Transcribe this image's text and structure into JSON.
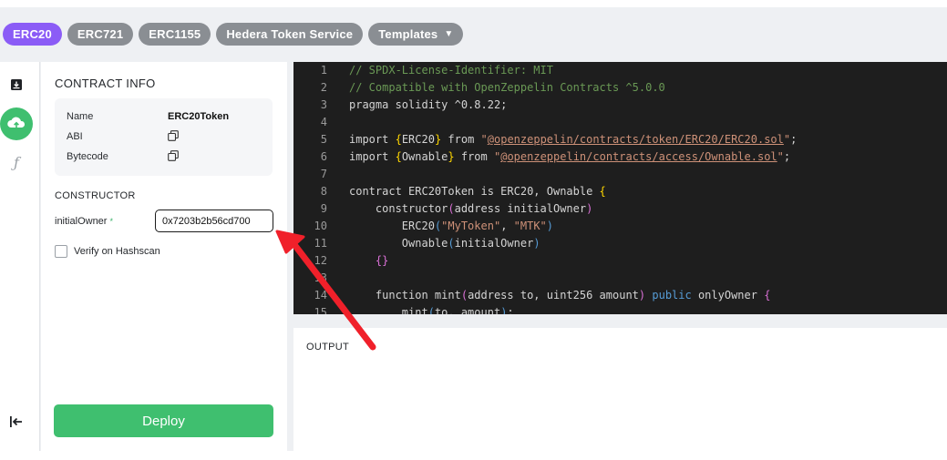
{
  "tabs": [
    {
      "label": "ERC20",
      "active": true
    },
    {
      "label": "ERC721",
      "active": false
    },
    {
      "label": "ERC1155",
      "active": false
    },
    {
      "label": "Hedera Token Service",
      "active": false
    },
    {
      "label": "Templates",
      "active": false,
      "icon": "caret-down-icon"
    }
  ],
  "rail": {
    "icons": [
      "download-icon",
      "cloud-upload-icon",
      "function-icon",
      "collapse-left-icon"
    ],
    "active_icon": "cloud-upload-icon"
  },
  "contract_info": {
    "title": "CONTRACT INFO",
    "rows": [
      {
        "label": "Name",
        "value": "ERC20Token"
      },
      {
        "label": "ABI",
        "icon": "copy-icon"
      },
      {
        "label": "Bytecode",
        "icon": "copy-icon"
      }
    ]
  },
  "constructor": {
    "title": "CONSTRUCTOR",
    "field_label": "initialOwner",
    "required_mark": "*",
    "field_value": "0x7203b2b56cd700",
    "verify_label": "Verify on Hashscan",
    "verify_checked": false
  },
  "deploy_label": "Deploy",
  "editor": {
    "line_numbers": [
      "1",
      "2",
      "3",
      "4",
      "5",
      "6",
      "7",
      "8",
      "9",
      "10",
      "11",
      "12",
      "13",
      "14",
      "15"
    ],
    "lines": {
      "l1": "// SPDX-License-Identifier: MIT",
      "l2": "// Compatible with OpenZeppelin Contracts ^5.0.0",
      "l3": "pragma solidity ^0.8.22;",
      "l5_a": "import ",
      "l5_b": "{",
      "l5_c": "ERC20",
      "l5_d": "}",
      "l5_e": " from ",
      "l5_f": "\"",
      "l5_g": "@openzeppelin/contracts/token/ERC20/ERC20.sol",
      "l5_h": "\"",
      "l5_i": ";",
      "l6_a": "import ",
      "l6_b": "{",
      "l6_c": "Ownable",
      "l6_d": "}",
      "l6_e": " from ",
      "l6_f": "\"",
      "l6_g": "@openzeppelin/contracts/access/Ownable.sol",
      "l6_h": "\"",
      "l6_i": ";",
      "l8_a": "contract ERC20Token is ERC20, Ownable ",
      "l8_b": "{",
      "l9_a": "    constructor",
      "l9_b": "(",
      "l9_c": "address initialOwner",
      "l9_d": ")",
      "l10_a": "        ERC20",
      "l10_b": "(",
      "l10_c": "\"MyToken\"",
      "l10_d": ", ",
      "l10_e": "\"MTK\"",
      "l10_f": ")",
      "l11_a": "        Ownable",
      "l11_b": "(",
      "l11_c": "initialOwner",
      "l11_d": ")",
      "l12": "    {}",
      "l14_a": "    function mint",
      "l14_b": "(",
      "l14_c": "address to, uint256 amount",
      "l14_d": ")",
      "l14_e": " public",
      "l14_f": " onlyOwner ",
      "l14_g": "{",
      "l15_a": "        mint",
      "l15_b": "(",
      "l15_c": "to, amount",
      "l15_d": ")",
      "l15_e": ";"
    }
  },
  "output": {
    "title": "OUTPUT"
  },
  "colors": {
    "accent_purple": "#8b5cf6",
    "deploy_green": "#3fbf6f",
    "annotation_red": "#f0202a"
  }
}
